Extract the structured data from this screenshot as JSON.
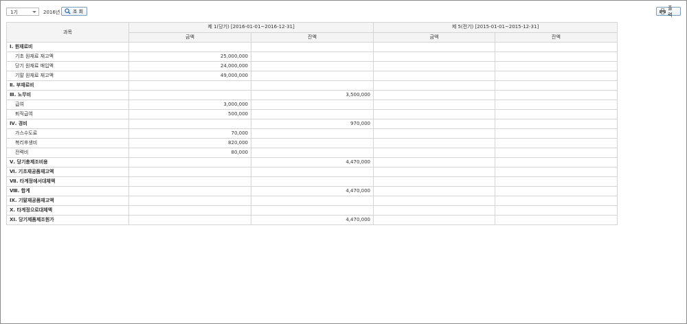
{
  "toolbar": {
    "period_select": "1기",
    "year_label": "2016년",
    "search_label": "조 회",
    "print_label": "출 력"
  },
  "table": {
    "header": {
      "account": "과목",
      "current_period": "제 1(당기) [2016-01-01~2016-12-31]",
      "prior_period": "제 5(전기) [2015-01-01~2015-12-31]",
      "amount": "금액",
      "balance": "잔액"
    },
    "rows": [
      {
        "label": "Ⅰ. 원재료비",
        "section": true,
        "cur_amount": "",
        "cur_balance": "",
        "prev_amount": "",
        "prev_balance": ""
      },
      {
        "label": "기초 원재료 재고액",
        "section": false,
        "cur_amount": "25,000,000",
        "cur_balance": "",
        "prev_amount": "",
        "prev_balance": ""
      },
      {
        "label": "당기 원재료 매입액",
        "section": false,
        "cur_amount": "24,000,000",
        "cur_balance": "",
        "prev_amount": "",
        "prev_balance": ""
      },
      {
        "label": "기말 원재료 재고액",
        "section": false,
        "cur_amount": "49,000,000",
        "cur_balance": "",
        "prev_amount": "",
        "prev_balance": ""
      },
      {
        "label": "Ⅱ. 부재료비",
        "section": true,
        "cur_amount": "",
        "cur_balance": "",
        "prev_amount": "",
        "prev_balance": ""
      },
      {
        "label": "Ⅲ. 노무비",
        "section": true,
        "cur_amount": "",
        "cur_balance": "3,500,000",
        "prev_amount": "",
        "prev_balance": ""
      },
      {
        "label": "급여",
        "section": false,
        "cur_amount": "3,000,000",
        "cur_balance": "",
        "prev_amount": "",
        "prev_balance": ""
      },
      {
        "label": "퇴직급여",
        "section": false,
        "cur_amount": "500,000",
        "cur_balance": "",
        "prev_amount": "",
        "prev_balance": ""
      },
      {
        "label": "Ⅳ. 경비",
        "section": true,
        "cur_amount": "",
        "cur_balance": "970,000",
        "prev_amount": "",
        "prev_balance": ""
      },
      {
        "label": "가스수도료",
        "section": false,
        "cur_amount": "70,000",
        "cur_balance": "",
        "prev_amount": "",
        "prev_balance": ""
      },
      {
        "label": "복리후생비",
        "section": false,
        "cur_amount": "820,000",
        "cur_balance": "",
        "prev_amount": "",
        "prev_balance": ""
      },
      {
        "label": "전력비",
        "section": false,
        "cur_amount": "80,000",
        "cur_balance": "",
        "prev_amount": "",
        "prev_balance": ""
      },
      {
        "label": "Ⅴ. 당기총제조비용",
        "section": true,
        "cur_amount": "",
        "cur_balance": "4,470,000",
        "prev_amount": "",
        "prev_balance": ""
      },
      {
        "label": "Ⅵ. 기초재공품재고액",
        "section": true,
        "cur_amount": "",
        "cur_balance": "",
        "prev_amount": "",
        "prev_balance": ""
      },
      {
        "label": "Ⅶ. 타계정에서대체액",
        "section": true,
        "cur_amount": "",
        "cur_balance": "",
        "prev_amount": "",
        "prev_balance": ""
      },
      {
        "label": "Ⅷ. 합계",
        "section": true,
        "cur_amount": "",
        "cur_balance": "4,470,000",
        "prev_amount": "",
        "prev_balance": ""
      },
      {
        "label": "Ⅸ. 기말재공품재고액",
        "section": true,
        "cur_amount": "",
        "cur_balance": "",
        "prev_amount": "",
        "prev_balance": ""
      },
      {
        "label": "Ⅹ. 타계정으로대체액",
        "section": true,
        "cur_amount": "",
        "cur_balance": "",
        "prev_amount": "",
        "prev_balance": ""
      },
      {
        "label": "ⅩⅠ. 당기제품제조원가",
        "section": true,
        "cur_amount": "",
        "cur_balance": "4,470,000",
        "prev_amount": "",
        "prev_balance": ""
      }
    ]
  }
}
